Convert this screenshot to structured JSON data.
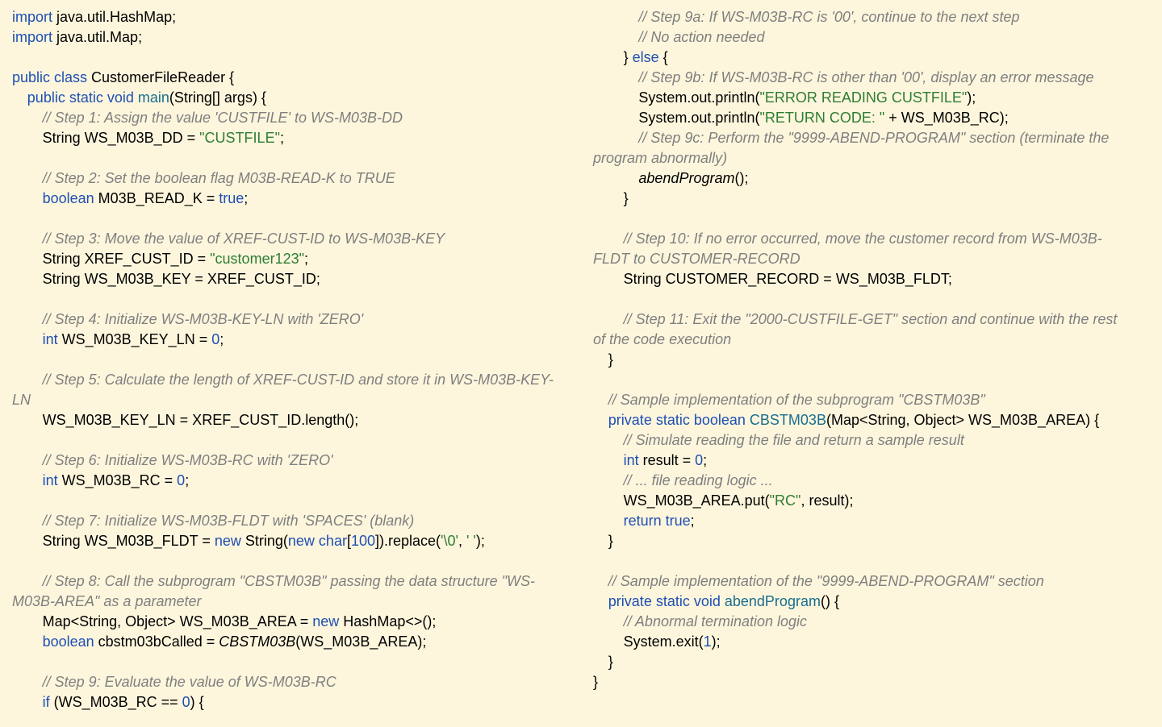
{
  "colors": {
    "background": "#fdf6dd",
    "keyword": "#1f4fb3",
    "string": "#2e7d32",
    "comment": "#7f7f7f",
    "method": "#1b6d8f"
  },
  "left": [
    {
      "i": 0,
      "t": [
        [
          "kw",
          "import"
        ],
        [
          "tx",
          " java.util.HashMap;"
        ]
      ]
    },
    {
      "i": 0,
      "t": [
        [
          "kw",
          "import"
        ],
        [
          "tx",
          " java.util.Map;"
        ]
      ]
    },
    {
      "i": 0,
      "t": []
    },
    {
      "i": 0,
      "t": [
        [
          "kw",
          "public class"
        ],
        [
          "tx",
          " CustomerFileReader {"
        ]
      ]
    },
    {
      "i": 1,
      "t": [
        [
          "kw",
          "public static void"
        ],
        [
          "tx",
          " "
        ],
        [
          "fn",
          "main"
        ],
        [
          "tx",
          "(String[] args) {"
        ]
      ]
    },
    {
      "i": 2,
      "t": [
        [
          "cm",
          "// Step 1: Assign the value 'CUSTFILE' to WS-M03B-DD"
        ]
      ]
    },
    {
      "i": 2,
      "t": [
        [
          "tx",
          "String WS_M03B_DD = "
        ],
        [
          "str",
          "\"CUSTFILE\""
        ],
        [
          "tx",
          ";"
        ]
      ]
    },
    {
      "i": 0,
      "t": []
    },
    {
      "i": 2,
      "t": [
        [
          "cm",
          "// Step 2: Set the boolean flag M03B-READ-K to TRUE"
        ]
      ]
    },
    {
      "i": 2,
      "t": [
        [
          "kw",
          "boolean"
        ],
        [
          "tx",
          " M03B_READ_K = "
        ],
        [
          "kw",
          "true"
        ],
        [
          "tx",
          ";"
        ]
      ]
    },
    {
      "i": 0,
      "t": []
    },
    {
      "i": 2,
      "t": [
        [
          "cm",
          "// Step 3: Move the value of XREF-CUST-ID to WS-M03B-KEY"
        ]
      ]
    },
    {
      "i": 2,
      "t": [
        [
          "tx",
          "String XREF_CUST_ID = "
        ],
        [
          "str",
          "\"customer123\""
        ],
        [
          "tx",
          ";"
        ]
      ]
    },
    {
      "i": 2,
      "t": [
        [
          "tx",
          "String WS_M03B_KEY = XREF_CUST_ID;"
        ]
      ]
    },
    {
      "i": 0,
      "t": []
    },
    {
      "i": 2,
      "t": [
        [
          "cm",
          "// Step 4: Initialize WS-M03B-KEY-LN with 'ZERO'"
        ]
      ]
    },
    {
      "i": 2,
      "t": [
        [
          "kw",
          "int"
        ],
        [
          "tx",
          " WS_M03B_KEY_LN = "
        ],
        [
          "num",
          "0"
        ],
        [
          "tx",
          ";"
        ]
      ]
    },
    {
      "i": 0,
      "t": []
    },
    {
      "i": 2,
      "t": [
        [
          "cm",
          "// Step 5: Calculate the length of XREF-CUST-ID and store it in WS-M03B-KEY-"
        ]
      ]
    },
    {
      "i": 0,
      "t": [
        [
          "cm",
          "LN"
        ]
      ]
    },
    {
      "i": 2,
      "t": [
        [
          "tx",
          "WS_M03B_KEY_LN = XREF_CUST_ID.length();"
        ]
      ]
    },
    {
      "i": 0,
      "t": []
    },
    {
      "i": 2,
      "t": [
        [
          "cm",
          "// Step 6: Initialize WS-M03B-RC with 'ZERO'"
        ]
      ]
    },
    {
      "i": 2,
      "t": [
        [
          "kw",
          "int"
        ],
        [
          "tx",
          " WS_M03B_RC = "
        ],
        [
          "num",
          "0"
        ],
        [
          "tx",
          ";"
        ]
      ]
    },
    {
      "i": 0,
      "t": []
    },
    {
      "i": 2,
      "t": [
        [
          "cm",
          "// Step 7: Initialize WS-M03B-FLDT with 'SPACES' (blank)"
        ]
      ]
    },
    {
      "i": 2,
      "t": [
        [
          "tx",
          "String WS_M03B_FLDT = "
        ],
        [
          "kw",
          "new"
        ],
        [
          "tx",
          " String("
        ],
        [
          "kw",
          "new char"
        ],
        [
          "tx",
          "["
        ],
        [
          "num",
          "100"
        ],
        [
          "tx",
          "]).replace("
        ],
        [
          "str",
          "'\\0'"
        ],
        [
          "tx",
          ", "
        ],
        [
          "str",
          "' '"
        ],
        [
          "tx",
          ");"
        ]
      ]
    },
    {
      "i": 0,
      "t": []
    },
    {
      "i": 2,
      "t": [
        [
          "cm",
          "// Step 8: Call the subprogram \"CBSTM03B\" passing the data structure \"WS-"
        ]
      ]
    },
    {
      "i": 0,
      "t": [
        [
          "cm",
          "M03B-AREA\" as a parameter"
        ]
      ]
    },
    {
      "i": 2,
      "t": [
        [
          "tx",
          "Map<String, Object> WS_M03B_AREA = "
        ],
        [
          "kw",
          "new"
        ],
        [
          "tx",
          " HashMap<>();"
        ]
      ]
    },
    {
      "i": 2,
      "t": [
        [
          "kw",
          "boolean"
        ],
        [
          "tx",
          " cbstm03bCalled = "
        ],
        [
          "it",
          "CBSTM03B"
        ],
        [
          "tx",
          "(WS_M03B_AREA);"
        ]
      ]
    },
    {
      "i": 0,
      "t": []
    },
    {
      "i": 2,
      "t": [
        [
          "cm",
          "// Step 9: Evaluate the value of WS-M03B-RC"
        ]
      ]
    },
    {
      "i": 2,
      "t": [
        [
          "kw",
          "if"
        ],
        [
          "tx",
          " (WS_M03B_RC == "
        ],
        [
          "num",
          "0"
        ],
        [
          "tx",
          ") {"
        ]
      ]
    }
  ],
  "right": [
    {
      "i": 3,
      "t": [
        [
          "cm",
          "// Step 9a: If WS-M03B-RC is '00', continue to the next step"
        ]
      ]
    },
    {
      "i": 3,
      "t": [
        [
          "cm",
          "// No action needed"
        ]
      ]
    },
    {
      "i": 2,
      "t": [
        [
          "tx",
          "} "
        ],
        [
          "kw",
          "else"
        ],
        [
          "tx",
          " {"
        ]
      ]
    },
    {
      "i": 3,
      "t": [
        [
          "cm",
          "// Step 9b: If WS-M03B-RC is other than '00', display an error message"
        ]
      ]
    },
    {
      "i": 3,
      "t": [
        [
          "tx",
          "System.out.println("
        ],
        [
          "str",
          "\"ERROR READING CUSTFILE\""
        ],
        [
          "tx",
          ");"
        ]
      ]
    },
    {
      "i": 3,
      "t": [
        [
          "tx",
          "System.out.println("
        ],
        [
          "str",
          "\"RETURN CODE: \""
        ],
        [
          "tx",
          " + WS_M03B_RC);"
        ]
      ]
    },
    {
      "i": 3,
      "t": [
        [
          "cm",
          "// Step 9c: Perform the \"9999-ABEND-PROGRAM\" section (terminate the"
        ]
      ]
    },
    {
      "i": 0,
      "t": [
        [
          "cm",
          "program abnormally)"
        ]
      ]
    },
    {
      "i": 3,
      "t": [
        [
          "it",
          "abendProgram"
        ],
        [
          "tx",
          "();"
        ]
      ]
    },
    {
      "i": 2,
      "t": [
        [
          "tx",
          "}"
        ]
      ]
    },
    {
      "i": 0,
      "t": []
    },
    {
      "i": 2,
      "t": [
        [
          "cm",
          "// Step 10: If no error occurred, move the customer record from WS-M03B-"
        ]
      ]
    },
    {
      "i": 0,
      "t": [
        [
          "cm",
          "FLDT to CUSTOMER-RECORD"
        ]
      ]
    },
    {
      "i": 2,
      "t": [
        [
          "tx",
          "String CUSTOMER_RECORD = WS_M03B_FLDT;"
        ]
      ]
    },
    {
      "i": 0,
      "t": []
    },
    {
      "i": 2,
      "t": [
        [
          "cm",
          "// Step 11: Exit the \"2000-CUSTFILE-GET\" section and continue with the rest"
        ]
      ]
    },
    {
      "i": 0,
      "t": [
        [
          "cm",
          "of the code execution"
        ]
      ]
    },
    {
      "i": 1,
      "t": [
        [
          "tx",
          "}"
        ]
      ]
    },
    {
      "i": 0,
      "t": []
    },
    {
      "i": 1,
      "t": [
        [
          "cm",
          "// Sample implementation of the subprogram \"CBSTM03B\""
        ]
      ]
    },
    {
      "i": 1,
      "t": [
        [
          "kw",
          "private static boolean"
        ],
        [
          "tx",
          " "
        ],
        [
          "fn",
          "CBSTM03B"
        ],
        [
          "tx",
          "(Map<String, Object> WS_M03B_AREA) {"
        ]
      ]
    },
    {
      "i": 2,
      "t": [
        [
          "cm",
          "// Simulate reading the file and return a sample result"
        ]
      ]
    },
    {
      "i": 2,
      "t": [
        [
          "kw",
          "int"
        ],
        [
          "tx",
          " result = "
        ],
        [
          "num",
          "0"
        ],
        [
          "tx",
          ";"
        ]
      ]
    },
    {
      "i": 2,
      "t": [
        [
          "cm",
          "// ... file reading logic ..."
        ]
      ]
    },
    {
      "i": 2,
      "t": [
        [
          "tx",
          "WS_M03B_AREA.put("
        ],
        [
          "str",
          "\"RC\""
        ],
        [
          "tx",
          ", result);"
        ]
      ]
    },
    {
      "i": 2,
      "t": [
        [
          "kw",
          "return true"
        ],
        [
          "tx",
          ";"
        ]
      ]
    },
    {
      "i": 1,
      "t": [
        [
          "tx",
          "}"
        ]
      ]
    },
    {
      "i": 0,
      "t": []
    },
    {
      "i": 1,
      "t": [
        [
          "cm",
          "// Sample implementation of the \"9999-ABEND-PROGRAM\" section"
        ]
      ]
    },
    {
      "i": 1,
      "t": [
        [
          "kw",
          "private static void"
        ],
        [
          "tx",
          " "
        ],
        [
          "fn",
          "abendProgram"
        ],
        [
          "tx",
          "() {"
        ]
      ]
    },
    {
      "i": 2,
      "t": [
        [
          "cm",
          "// Abnormal termination logic"
        ]
      ]
    },
    {
      "i": 2,
      "t": [
        [
          "tx",
          "System.exit("
        ],
        [
          "num",
          "1"
        ],
        [
          "tx",
          ");"
        ]
      ]
    },
    {
      "i": 1,
      "t": [
        [
          "tx",
          "}"
        ]
      ]
    },
    {
      "i": 0,
      "t": [
        [
          "tx",
          "}"
        ]
      ]
    }
  ]
}
